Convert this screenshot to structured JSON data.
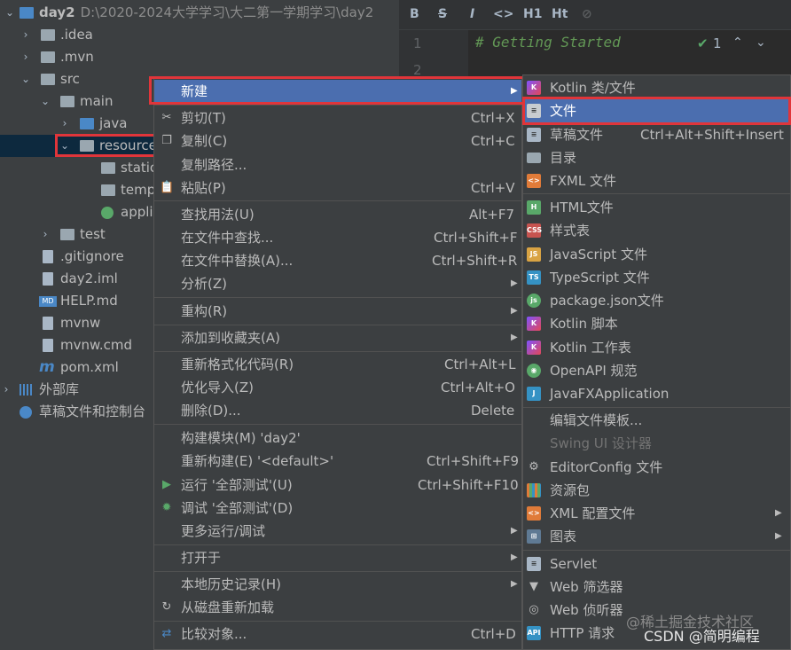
{
  "project": {
    "name": "day2",
    "path": "D:\\2020-2024大学学习\\大二第一学期学习\\day2",
    "items": [
      {
        "label": ".idea"
      },
      {
        "label": ".mvn"
      },
      {
        "label": "src"
      },
      {
        "label": "main"
      },
      {
        "label": "java"
      },
      {
        "label": "resource"
      },
      {
        "label": "static"
      },
      {
        "label": "temp"
      },
      {
        "label": "appli"
      },
      {
        "label": "test"
      },
      {
        "label": ".gitignore"
      },
      {
        "label": "day2.iml"
      },
      {
        "label": "HELP.md"
      },
      {
        "label": "mvnw"
      },
      {
        "label": "mvnw.cmd"
      },
      {
        "label": "pom.xml"
      },
      {
        "label": "外部库"
      },
      {
        "label": "草稿文件和控制台"
      }
    ]
  },
  "editor": {
    "line1": "1",
    "line2": "2",
    "code_line1": "# Getting Started",
    "check_count": "1",
    "toolbar": {
      "bold": "B",
      "strike": "S",
      "italic": "I",
      "code": "<>",
      "h1": "H1",
      "ht": "Ht"
    }
  },
  "context_menu": {
    "items": [
      {
        "label": "新建",
        "shortcut": ""
      },
      {
        "label": "剪切(T)",
        "shortcut": "Ctrl+X"
      },
      {
        "label": "复制(C)",
        "shortcut": "Ctrl+C"
      },
      {
        "label": "复制路径...",
        "shortcut": ""
      },
      {
        "label": "粘贴(P)",
        "shortcut": "Ctrl+V"
      },
      {
        "label": "查找用法(U)",
        "shortcut": "Alt+F7"
      },
      {
        "label": "在文件中查找...",
        "shortcut": "Ctrl+Shift+F"
      },
      {
        "label": "在文件中替换(A)...",
        "shortcut": "Ctrl+Shift+R"
      },
      {
        "label": "分析(Z)",
        "shortcut": ""
      },
      {
        "label": "重构(R)",
        "shortcut": ""
      },
      {
        "label": "添加到收藏夹(A)",
        "shortcut": ""
      },
      {
        "label": "重新格式化代码(R)",
        "shortcut": "Ctrl+Alt+L"
      },
      {
        "label": "优化导入(Z)",
        "shortcut": "Ctrl+Alt+O"
      },
      {
        "label": "删除(D)...",
        "shortcut": "Delete"
      },
      {
        "label": "构建模块(M) 'day2'",
        "shortcut": ""
      },
      {
        "label": "重新构建(E) '<default>'",
        "shortcut": "Ctrl+Shift+F9"
      },
      {
        "label": "运行 '全部测试'(U)",
        "shortcut": "Ctrl+Shift+F10"
      },
      {
        "label": "调试 '全部测试'(D)",
        "shortcut": ""
      },
      {
        "label": "更多运行/调试",
        "shortcut": ""
      },
      {
        "label": "打开于",
        "shortcut": ""
      },
      {
        "label": "本地历史记录(H)",
        "shortcut": ""
      },
      {
        "label": "从磁盘重新加载",
        "shortcut": ""
      },
      {
        "label": "比较对象...",
        "shortcut": "Ctrl+D"
      }
    ]
  },
  "submenu": {
    "items": [
      {
        "label": "Kotlin 类/文件",
        "shortcut": ""
      },
      {
        "label": "文件",
        "shortcut": ""
      },
      {
        "label": "草稿文件",
        "shortcut": "Ctrl+Alt+Shift+Insert"
      },
      {
        "label": "目录",
        "shortcut": ""
      },
      {
        "label": "FXML 文件",
        "shortcut": ""
      },
      {
        "label": "HTML文件",
        "shortcut": ""
      },
      {
        "label": "样式表",
        "shortcut": ""
      },
      {
        "label": "JavaScript 文件",
        "shortcut": ""
      },
      {
        "label": "TypeScript 文件",
        "shortcut": ""
      },
      {
        "label": "package.json文件",
        "shortcut": ""
      },
      {
        "label": "Kotlin 脚本",
        "shortcut": ""
      },
      {
        "label": "Kotlin 工作表",
        "shortcut": ""
      },
      {
        "label": "OpenAPI 规范",
        "shortcut": ""
      },
      {
        "label": "JavaFXApplication",
        "shortcut": ""
      },
      {
        "label": "编辑文件模板...",
        "shortcut": ""
      },
      {
        "label": "Swing UI 设计器",
        "shortcut": ""
      },
      {
        "label": "EditorConfig 文件",
        "shortcut": ""
      },
      {
        "label": "资源包",
        "shortcut": ""
      },
      {
        "label": "XML 配置文件",
        "shortcut": ""
      },
      {
        "label": "图表",
        "shortcut": ""
      },
      {
        "label": "Servlet",
        "shortcut": ""
      },
      {
        "label": "Web 筛选器",
        "shortcut": ""
      },
      {
        "label": "Web 侦听器",
        "shortcut": ""
      },
      {
        "label": "HTTP 请求",
        "shortcut": ""
      }
    ]
  },
  "watermark": {
    "juejin": "@稀土掘金技术社区",
    "csdn": "CSDN @简明编程"
  }
}
